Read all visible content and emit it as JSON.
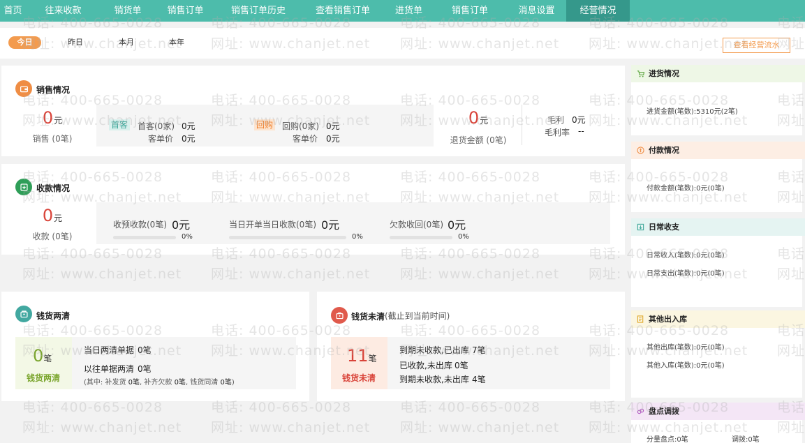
{
  "nav": {
    "items": [
      {
        "label": "首页",
        "active": false
      },
      {
        "label": "往来收款",
        "active": false
      },
      {
        "label": "销货单",
        "active": false
      },
      {
        "label": "销售订单",
        "active": false
      },
      {
        "label": "销售订单历史",
        "active": false
      },
      {
        "label": "查看销售订单",
        "active": false
      },
      {
        "label": "进货单",
        "active": false
      },
      {
        "label": "销售订单",
        "active": false
      },
      {
        "label": "消息设置",
        "active": false
      },
      {
        "label": "经营情况",
        "active": true
      }
    ]
  },
  "periods": {
    "today": "今日",
    "yesterday": "昨日",
    "month": "本月",
    "year": "本年"
  },
  "flow_button": "查看经营流水",
  "sales": {
    "title": "销售情况",
    "amount": "0",
    "unit": "元",
    "label": "销售 (0笔)",
    "first_tag": "首客",
    "first_customers": "首客(0家)",
    "first_value": "0元",
    "first_avg_label": "客单价",
    "first_avg_value": "0元",
    "repeat_tag": "回购",
    "repeat_customers": "回购(0家)",
    "repeat_value": "0元",
    "repeat_avg_label": "客单价",
    "repeat_avg_value": "0元",
    "refund_amount": "0",
    "refund_unit": "元",
    "refund_label": "退货金额 (0笔)",
    "gross_profit_label": "毛利",
    "gross_profit_value": "0元",
    "gross_margin_label": "毛利率",
    "gross_margin_value": "--"
  },
  "receipts": {
    "title": "收款情况",
    "amount": "0",
    "unit": "元",
    "label": "收款 (0笔)",
    "items": [
      {
        "label": "收预收款(0笔)",
        "value": "0元",
        "pct": "0%",
        "fraction": 0
      },
      {
        "label": "当日开单当日收款(0笔)",
        "value": "0元",
        "pct": "0%",
        "fraction": 0
      },
      {
        "label": "欠款收回(0笔)",
        "value": "0元",
        "pct": "0%",
        "fraction": 0
      }
    ]
  },
  "settled": {
    "title": "钱货两清",
    "count": "0",
    "unit": "笔",
    "label": "钱货两清",
    "today_label": "当日两清单据",
    "today_value": "0笔",
    "past_label": "以往单据两清",
    "past_value": "0笔",
    "detail_prefix": "(其中: 补发货",
    "detail_a": "0笔",
    "detail_mid1": ", 补齐欠款",
    "detail_b": "0笔",
    "detail_mid2": ", 钱货同清",
    "detail_c": "0笔",
    "detail_suffix": ")"
  },
  "unsettled": {
    "title": "钱货未清",
    "subtitle": "(截止到当前时间)",
    "count": "11",
    "unit": "笔",
    "label": "钱货未清",
    "rows": [
      {
        "label": "到期未收款,已出库",
        "value": "7笔"
      },
      {
        "label": "已收款,未出库",
        "value": "0笔"
      },
      {
        "label": "到期未收款,未出库",
        "value": "4笔"
      }
    ]
  },
  "sidebar": {
    "purchase": {
      "title": "进货情况",
      "line": "进货金额(笔数):5310元(2笔)",
      "color": "#eef7e6"
    },
    "payment": {
      "title": "付款情况",
      "line": "付款金额(笔数):0元(0笔)",
      "color": "#fdeee4"
    },
    "daily": {
      "title": "日常收支",
      "line1": "日常收入(笔数):0元(0笔)",
      "line2": "日常支出(笔数):0元(0笔)",
      "color": "#e5f4f2"
    },
    "other": {
      "title": "其他出入库",
      "line1": "其他出库(笔数):0元(0笔)",
      "line2": "其他入库(笔数):0元(0笔)",
      "color": "#fbf6e1"
    },
    "stock": {
      "title": "盘点调拨",
      "line1": "分量盘点:0笔",
      "line2": "调拨:0笔",
      "color": "#f4e6f6"
    }
  },
  "watermark": {
    "phone": "电话: 400-665-0028",
    "site": "网址: www.chanjet.net"
  }
}
